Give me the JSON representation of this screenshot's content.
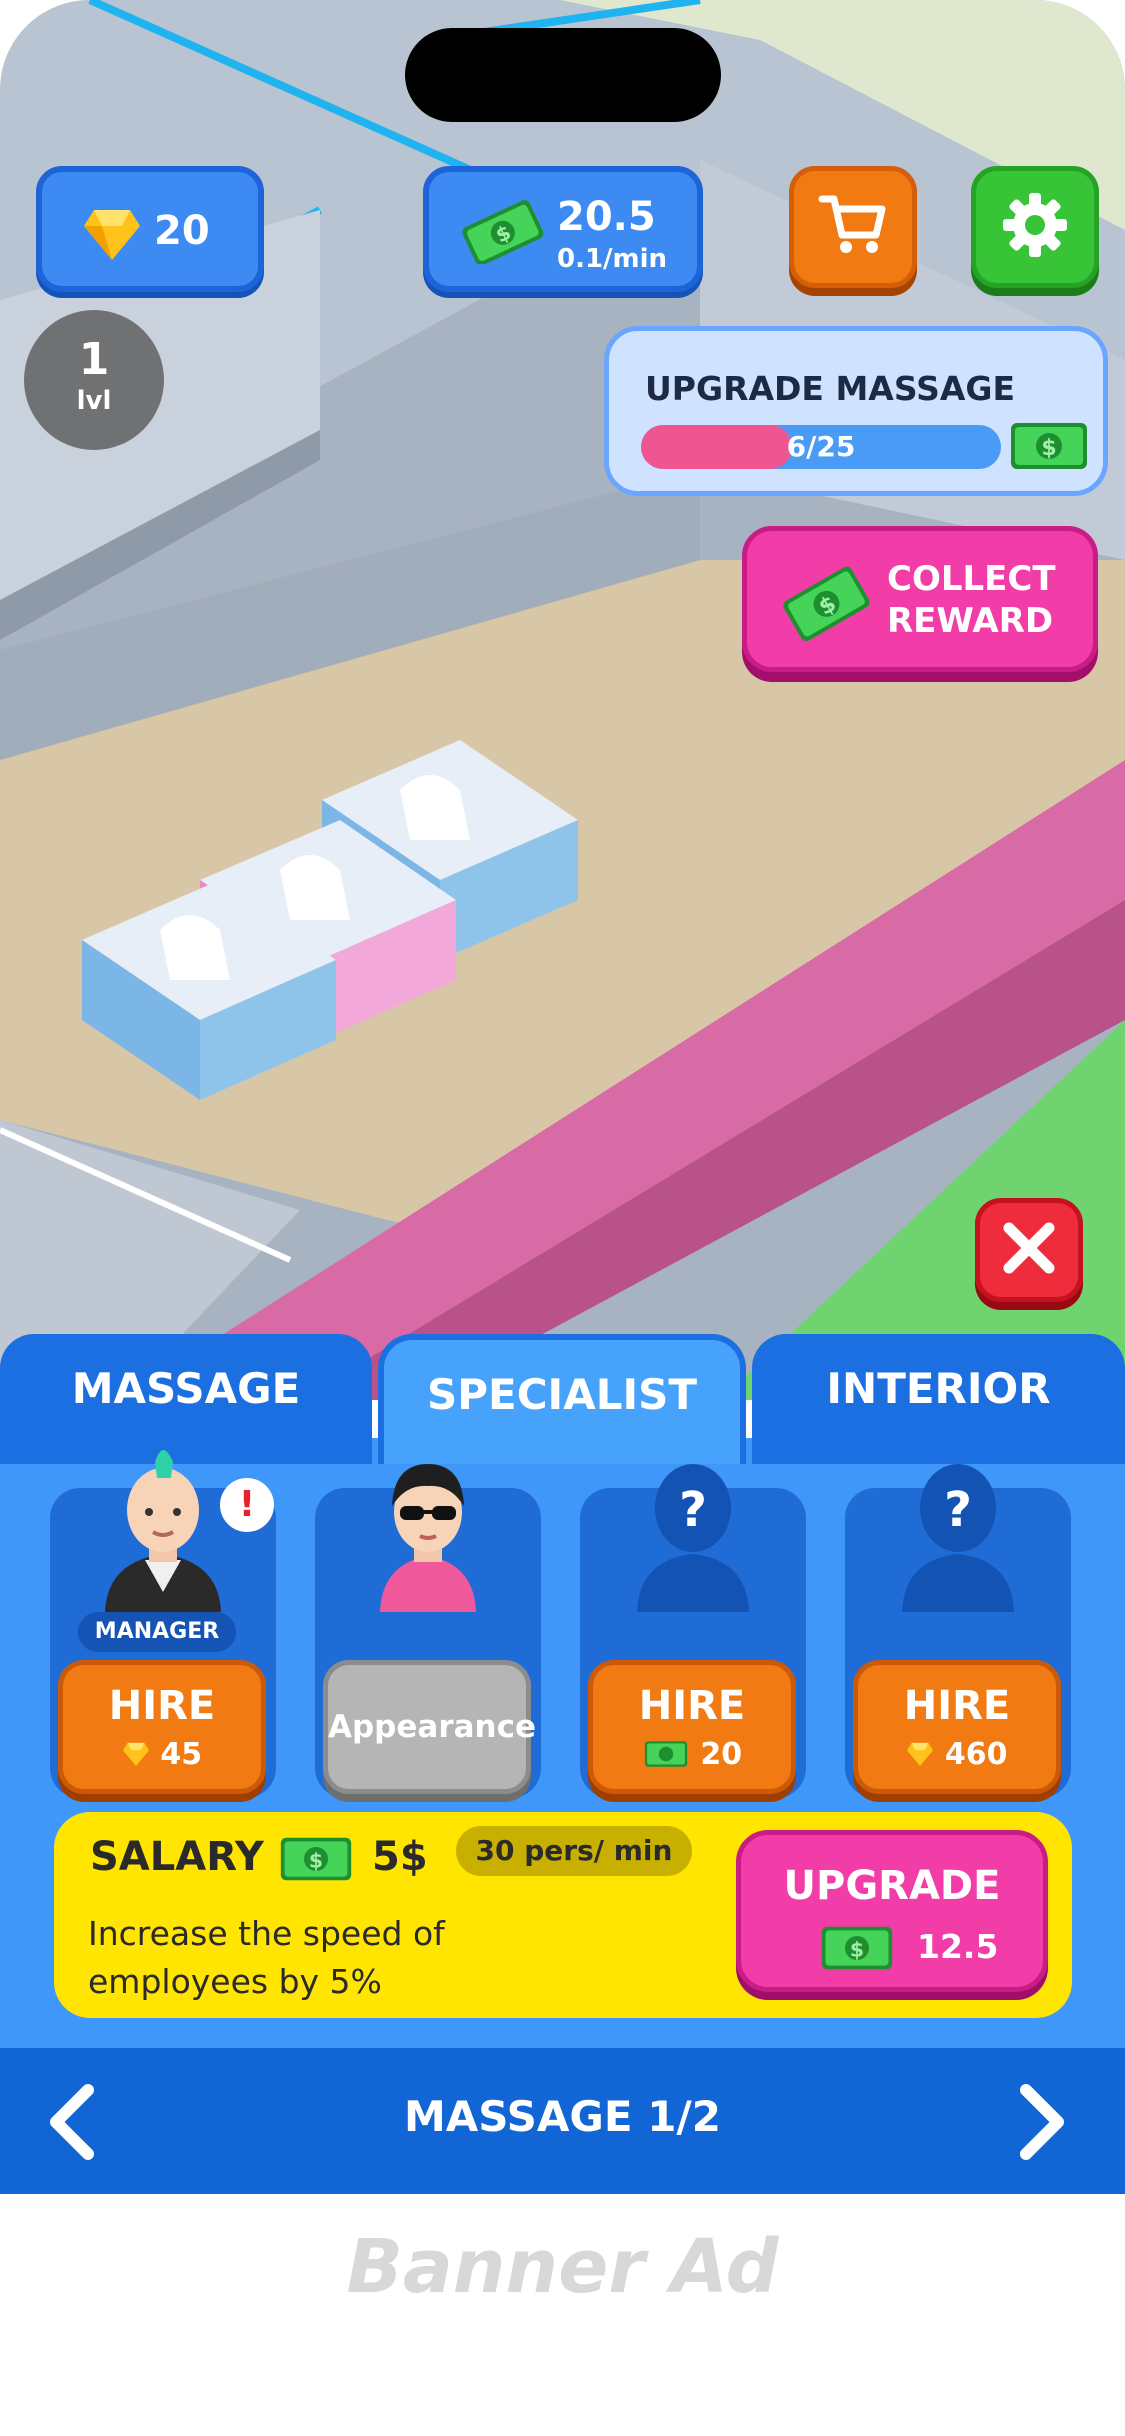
{
  "hud": {
    "gems": "20",
    "cash": "20.5",
    "cash_rate": "0.1/min",
    "level_number": "1",
    "level_label": "lvl",
    "icons": {
      "gem": "gem-icon",
      "cash": "cash-bill-icon",
      "cart": "cart-icon",
      "settings": "gear-icon"
    }
  },
  "upgrade_massage": {
    "title": "UPGRADE MASSAGE",
    "progress_text": "6/25",
    "progress_current": 6,
    "progress_total": 25
  },
  "collect_reward": {
    "line1": "COLLECT",
    "line2": "REWARD"
  },
  "tabs": [
    {
      "label": "MASSAGE",
      "active": false
    },
    {
      "label": "SPECIALIST",
      "active": true
    },
    {
      "label": "INTERIOR",
      "active": false
    }
  ],
  "specialists": [
    {
      "badge": "MANAGER",
      "alert": "!",
      "action": "HIRE",
      "price": "45",
      "currency": "gem"
    },
    {
      "action": "Appearance"
    },
    {
      "locked": "?",
      "action": "HIRE",
      "price": "20",
      "currency": "cash"
    },
    {
      "locked": "?",
      "action": "HIRE",
      "price": "460",
      "currency": "gem"
    }
  ],
  "salary": {
    "label": "SALARY",
    "amount": "5$",
    "rate": "30 pers/ min",
    "description": "Increase the speed of employees by 5%",
    "upgrade_label": "UPGRADE",
    "upgrade_price": "12.5"
  },
  "footer": {
    "label": "MASSAGE 1/2"
  },
  "ad": {
    "label": "Banner Ad"
  },
  "colors": {
    "panel_blue": "#3f97fa",
    "hire_orange": "#f27a12",
    "upgrade_pink": "#f23ca8",
    "salary_yellow": "#ffe500",
    "progress_pink": "#ef5591"
  }
}
